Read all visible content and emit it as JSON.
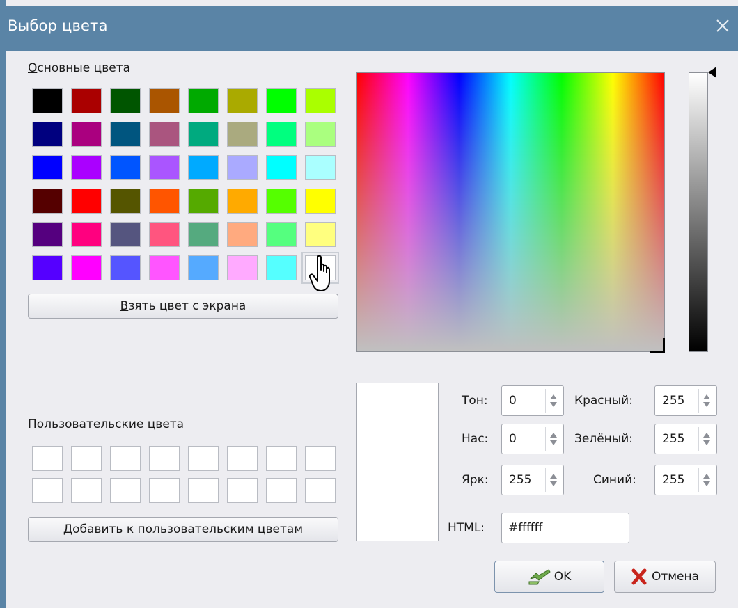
{
  "window": {
    "title": "Выбор цвета"
  },
  "basic_colors": {
    "label": "Основные цвета",
    "swatches": [
      "#000000",
      "#aa0000",
      "#005500",
      "#aa5500",
      "#00aa00",
      "#aaaa00",
      "#00ff00",
      "#aaff00",
      "#00007f",
      "#aa007f",
      "#00557f",
      "#aa557f",
      "#00aa7f",
      "#aaaa7f",
      "#00ff7f",
      "#aaff7f",
      "#0000ff",
      "#aa00ff",
      "#0055ff",
      "#aa55ff",
      "#00aaff",
      "#aaaaff",
      "#00ffff",
      "#aaffff",
      "#550000",
      "#ff0000",
      "#555500",
      "#ff5500",
      "#55aa00",
      "#ffaa00",
      "#55ff00",
      "#ffff00",
      "#55007f",
      "#ff007f",
      "#55557f",
      "#ff557f",
      "#55aa7f",
      "#ffaa7f",
      "#55ff7f",
      "#ffff7f",
      "#5500ff",
      "#ff00ff",
      "#5555ff",
      "#ff55ff",
      "#55aaff",
      "#ffaaff",
      "#55ffff",
      "#ffffff"
    ],
    "selected_index": 47
  },
  "pick_screen_button": "Взять цвет с экрана",
  "custom_colors": {
    "label": "Пользовательские цвета",
    "count": 16
  },
  "add_custom_button": "Добавить к пользовательским цветам",
  "fields": {
    "hue": {
      "label": "Тон:",
      "value": "0"
    },
    "sat": {
      "label": "Нас:",
      "value": "0"
    },
    "val": {
      "label": "Ярк:",
      "value": "255"
    },
    "red": {
      "label": "Красный:",
      "value": "255"
    },
    "green": {
      "label": "Зелёный:",
      "value": "255"
    },
    "blue": {
      "label": "Синий:",
      "value": "255"
    },
    "html": {
      "label": "HTML:",
      "value": "#ffffff"
    }
  },
  "ok_button": "OK",
  "cancel_button": "Отмена",
  "colors": {
    "titlebar": "#5a84a6",
    "background": "#ededf1"
  }
}
